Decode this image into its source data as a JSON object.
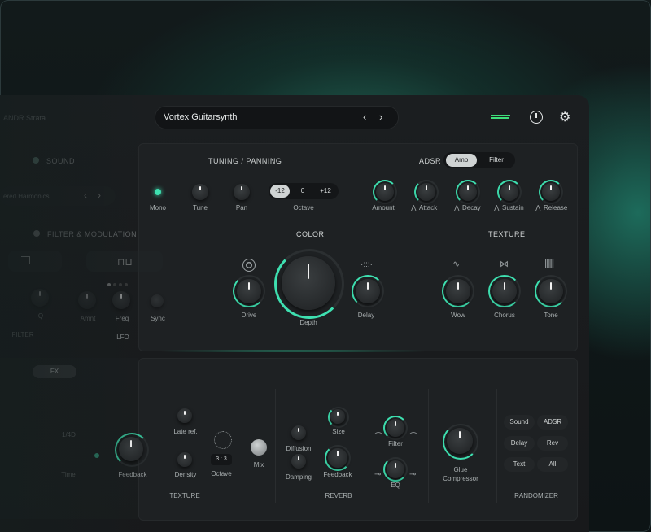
{
  "app": {
    "name": "ANDR Strata"
  },
  "preset": {
    "name": "Vortex Guitarsynth",
    "prev": "‹",
    "next": "›"
  },
  "left": {
    "sound_label": "SOUND",
    "harmonics_label": "ered Harmonics",
    "filter_mod_label": "FILTER & MODULATION",
    "q_label": "Q",
    "filter_label": "FILTER",
    "amnt_label": "Amnt",
    "freq_label": "Freq",
    "sync_label": "Sync",
    "lfo_label": "LFO"
  },
  "tuning": {
    "title": "TUNING / PANNING",
    "mono": "Mono",
    "tune": "Tune",
    "pan": "Pan",
    "octave": "Octave",
    "octave_options": [
      "-12",
      "0",
      "+12"
    ],
    "octave_selected": "-12"
  },
  "adsr": {
    "title": "ADSR",
    "tabs": [
      "Amp",
      "Filter"
    ],
    "active_tab": "Amp",
    "amount": "Amount",
    "attack": "Attack",
    "decay": "Decay",
    "sustain": "Sustain",
    "release": "Release"
  },
  "color": {
    "title": "COLOR",
    "drive": "Drive",
    "depth": "Depth",
    "delay": "Delay"
  },
  "texture": {
    "title": "TEXTURE",
    "wow": "Wow",
    "chorus": "Chorus",
    "tone": "Tone"
  },
  "fx": {
    "tab_label": "FX",
    "delay_time_value": "1/4D",
    "time_label": "Time",
    "feedback_label": "Feedback",
    "late_ref": "Late ref.",
    "density": "Density",
    "octave": "Octave",
    "octave_value": "3 : 3",
    "mix": "Mix",
    "texture_section": "TEXTURE",
    "diffusion": "Diffusion",
    "size": "Size",
    "damping": "Damping",
    "reverb_feedback": "Feedback",
    "reverb_section": "REVERB",
    "filter": "Filter",
    "eq": "EQ",
    "glue_compressor": "Glue\nCompressor",
    "randomizer_section": "RANDOMIZER",
    "randomizer_buttons": [
      "Sound",
      "ADSR",
      "Delay",
      "Rev",
      "Text",
      "All"
    ]
  },
  "colors": {
    "accent": "#3ee0b0",
    "background": "#1b1e20",
    "panel": "#1e2123"
  }
}
